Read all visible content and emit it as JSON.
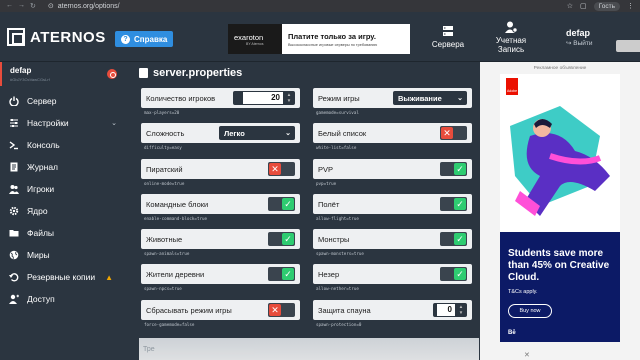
{
  "browser": {
    "url": "aternos.org/options/",
    "guest_label": "Гость"
  },
  "header": {
    "logo_text": "ATERNOS",
    "help_label": "Справка",
    "ad": {
      "brand": "exaroton",
      "brand_sub": "BY Aternos",
      "headline": "Платите только за игру.",
      "subline": "Высококлассные игровые серверы по требованию"
    },
    "servers_label": "Сервера",
    "account_label_1": "Учетная",
    "account_label_2": "Запись",
    "user_name": "defap",
    "logout_label": "Выйти"
  },
  "sidebar": {
    "server_name": "defap",
    "server_id": "#GbJY3OcVawCGsLrf",
    "items": [
      {
        "label": "Сервер",
        "icon": "power-icon"
      },
      {
        "label": "Настройки",
        "icon": "sliders-icon",
        "expandable": true
      },
      {
        "label": "Консоль",
        "icon": "terminal-icon"
      },
      {
        "label": "Журнал",
        "icon": "log-icon"
      },
      {
        "label": "Игроки",
        "icon": "players-icon"
      },
      {
        "label": "Ядро",
        "icon": "gear-icon"
      },
      {
        "label": "Файлы",
        "icon": "folder-icon"
      },
      {
        "label": "Миры",
        "icon": "globe-icon"
      },
      {
        "label": "Резервные копии",
        "icon": "backup-icon",
        "warning": true
      },
      {
        "label": "Доступ",
        "icon": "access-icon"
      }
    ]
  },
  "main": {
    "title": "server.properties",
    "left": [
      {
        "label": "Количество игроков",
        "key": "max-players=20",
        "type": "number",
        "value": "20"
      },
      {
        "label": "Сложность",
        "key": "difficulty=easy",
        "type": "select",
        "value": "Легко"
      },
      {
        "label": "Пиратский",
        "key": "online-mode=true",
        "type": "toggle",
        "on": false
      },
      {
        "label": "Командные блоки",
        "key": "enable-command-block=true",
        "type": "toggle",
        "on": true
      },
      {
        "label": "Животные",
        "key": "spawn-animals=true",
        "type": "toggle",
        "on": true
      },
      {
        "label": "Жители деревни",
        "key": "spawn-npcs=true",
        "type": "toggle",
        "on": true
      },
      {
        "label": "Сбрасывать режим игры",
        "key": "force-gamemode=false",
        "type": "toggle",
        "on": false
      }
    ],
    "right": [
      {
        "label": "Режим игры",
        "key": "gamemode=survival",
        "type": "select",
        "value": "Выживание"
      },
      {
        "label": "Белый список",
        "key": "white-list=false",
        "type": "toggle",
        "on": false
      },
      {
        "label": "PVP",
        "key": "pvp=true",
        "type": "toggle",
        "on": true
      },
      {
        "label": "Полёт",
        "key": "allow-flight=true",
        "type": "toggle",
        "on": true
      },
      {
        "label": "Монстры",
        "key": "spawn-monsters=true",
        "type": "toggle",
        "on": true
      },
      {
        "label": "Незер",
        "key": "allow-nether=true",
        "type": "toggle",
        "on": true
      },
      {
        "label": "Защита спауна",
        "key": "spawn-protection=0",
        "type": "number",
        "value": "0"
      }
    ],
    "partial_row_label": "Тре"
  },
  "right_ad": {
    "label": "Рекламное объявление",
    "brand": "Adobe",
    "headline": "Students save more than 45% on Creative Cloud.",
    "terms": "T&Cs apply.",
    "button": "Buy now",
    "footer": "Bē"
  },
  "colors": {
    "bg": "#2b3540",
    "toggle_on": "#2ecc71",
    "toggle_off": "#e74c3c",
    "help_button": "#2f8ee0"
  }
}
